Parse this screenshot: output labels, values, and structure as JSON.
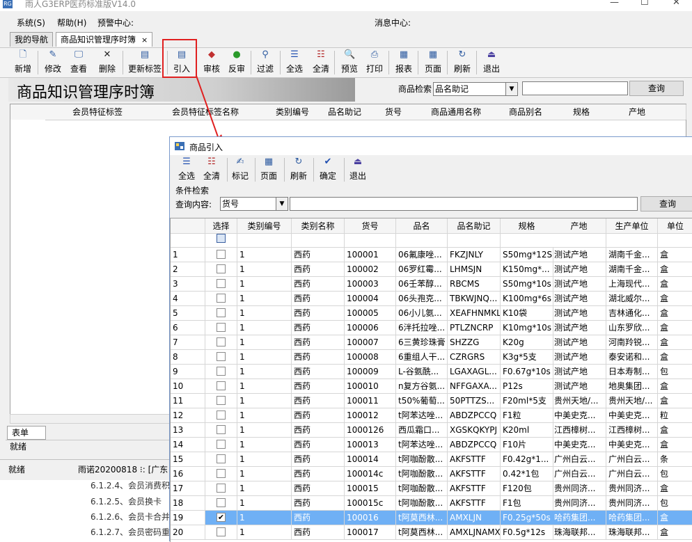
{
  "window": {
    "title": "雨人G3ERP医药标准版V14.0"
  },
  "menu": {
    "system": "系统(S)",
    "help": "帮助(H)",
    "warning": "预警中心:",
    "message": "消息中心:"
  },
  "tabs": [
    {
      "label": "我的导航"
    },
    {
      "label": "商品知识管理序时簿"
    }
  ],
  "tab_close": "×",
  "toolbar": [
    {
      "label": "新增",
      "icon": "new-icon"
    },
    {
      "label": "修改",
      "icon": "edit-icon"
    },
    {
      "label": "查看",
      "icon": "view-icon"
    },
    {
      "label": "删除",
      "icon": "delete-icon"
    },
    {
      "label": "更新标签",
      "icon": "update-tag-icon"
    },
    {
      "label": "引入",
      "icon": "import-icon"
    },
    {
      "label": "审核",
      "icon": "audit-icon"
    },
    {
      "label": "反审",
      "icon": "unaudit-icon"
    },
    {
      "label": "过滤",
      "icon": "filter-icon"
    },
    {
      "label": "全选",
      "icon": "select-all-icon"
    },
    {
      "label": "全清",
      "icon": "clear-all-icon"
    },
    {
      "label": "预览",
      "icon": "preview-icon"
    },
    {
      "label": "打印",
      "icon": "print-icon"
    },
    {
      "label": "报表",
      "icon": "report-icon"
    },
    {
      "label": "页面",
      "icon": "page-icon"
    },
    {
      "label": "刷新",
      "icon": "refresh-icon"
    },
    {
      "label": "退出",
      "icon": "exit-icon"
    }
  ],
  "banner": {
    "title": "商品知识管理序时簿"
  },
  "search": {
    "label": "商品检索",
    "field": "品名助记",
    "button": "查询"
  },
  "main_grid": {
    "columns": [
      "会员特征标签",
      "会员特征标签名称",
      "类别编号",
      "品名助记",
      "货号",
      "商品通用名称",
      "商品别名",
      "规格",
      "产地"
    ]
  },
  "bottom_tab": "表单",
  "status": {
    "ready": "就绪",
    "ready2": "就绪",
    "info": "雨诺20200818 ⁝: [广东"
  },
  "doc_lines": [
    "6.1.2.4、会员消费积分",
    "6.1.2.5、会员换卡",
    "6.1.2.6、会员卡合并",
    "6.1.2.7、会员密码重置"
  ],
  "dialog": {
    "title": "商品引入",
    "toolbar": [
      {
        "label": "全选",
        "icon": "select-all-icon"
      },
      {
        "label": "全清",
        "icon": "clear-all-icon"
      },
      {
        "label": "标记",
        "icon": "mark-icon"
      },
      {
        "label": "页面",
        "icon": "page-icon"
      },
      {
        "label": "刷新",
        "icon": "refresh-icon"
      },
      {
        "label": "确定",
        "icon": "check-icon"
      },
      {
        "label": "退出",
        "icon": "exit-icon"
      }
    ],
    "condition_label": "条件检索",
    "query_label": "查询内容:",
    "query_field": "货号",
    "query_button": "查询",
    "columns": [
      "选择",
      "类别编号",
      "类别名称",
      "货号",
      "品名",
      "品名助记",
      "规格",
      "产地",
      "生产单位",
      "单位"
    ],
    "rows": [
      {
        "n": "1",
        "checked": false,
        "cat": "1",
        "catname": "西药",
        "code": "100001",
        "name": "06氟康唑...",
        "mnem": "FKZJNLY",
        "spec": "S50mg*12S",
        "origin": "测试产地",
        "maker": "湖南千金...",
        "unit": "盒"
      },
      {
        "n": "2",
        "checked": false,
        "cat": "1",
        "catname": "西药",
        "code": "100002",
        "name": "06罗红霉...",
        "mnem": "LHMSJN",
        "spec": "K150mg*...",
        "origin": "测试产地",
        "maker": "湖南千金...",
        "unit": "盒"
      },
      {
        "n": "3",
        "checked": false,
        "cat": "1",
        "catname": "西药",
        "code": "100003",
        "name": "06壬苯醇...",
        "mnem": "RBCMS",
        "spec": "S50mg*10s",
        "origin": "测试产地",
        "maker": "上海现代...",
        "unit": "盒"
      },
      {
        "n": "4",
        "checked": false,
        "cat": "1",
        "catname": "西药",
        "code": "100004",
        "name": "06头孢克...",
        "mnem": "TBKWJNQ...",
        "spec": "K100mg*6s",
        "origin": "测试产地",
        "maker": "湖北威尔...",
        "unit": "盒"
      },
      {
        "n": "5",
        "checked": false,
        "cat": "1",
        "catname": "西药",
        "code": "100005",
        "name": "06小儿氨...",
        "mnem": "XEAFHNMKL",
        "spec": "K10袋",
        "origin": "测试产地",
        "maker": "吉林通化...",
        "unit": "盒"
      },
      {
        "n": "6",
        "checked": false,
        "cat": "1",
        "catname": "西药",
        "code": "100006",
        "name": "6泮托拉唑...",
        "mnem": "PTLZNCRP",
        "spec": "K10mg*10s",
        "origin": "测试产地",
        "maker": "山东罗欣...",
        "unit": "盒"
      },
      {
        "n": "7",
        "checked": false,
        "cat": "1",
        "catname": "西药",
        "code": "100007",
        "name": "6三黄珍珠膏",
        "mnem": "SHZZG",
        "spec": "K20g",
        "origin": "测试产地",
        "maker": "河南羚锐...",
        "unit": "盒"
      },
      {
        "n": "8",
        "checked": false,
        "cat": "1",
        "catname": "西药",
        "code": "100008",
        "name": "6重组人干...",
        "mnem": "CZRGRS",
        "spec": "K3g*5支",
        "origin": "测试产地",
        "maker": "泰安诺和...",
        "unit": "盒"
      },
      {
        "n": "9",
        "checked": false,
        "cat": "1",
        "catname": "西药",
        "code": "100009",
        "name": "L-谷氨酰...",
        "mnem": "LGAXAGL...",
        "spec": "F0.67g*10s",
        "origin": "测试产地",
        "maker": "日本寿制...",
        "unit": "包"
      },
      {
        "n": "10",
        "checked": false,
        "cat": "1",
        "catname": "西药",
        "code": "100010",
        "name": "n复方谷氨...",
        "mnem": "NFFGAXA...",
        "spec": "P12s",
        "origin": "测试产地",
        "maker": "地奥集团...",
        "unit": "盒"
      },
      {
        "n": "11",
        "checked": false,
        "cat": "1",
        "catname": "西药",
        "code": "100011",
        "name": "t50%葡萄...",
        "mnem": "50PTTZS...",
        "spec": "F20ml*5支",
        "origin": "贵州天地/...",
        "maker": "贵州天地/...",
        "unit": "盒"
      },
      {
        "n": "12",
        "checked": false,
        "cat": "1",
        "catname": "西药",
        "code": "100012",
        "name": "t阿苯达唑...",
        "mnem": "ABDZPCCQ",
        "spec": "F1粒",
        "origin": "中美史克...",
        "maker": "中美史克...",
        "unit": "粒"
      },
      {
        "n": "13",
        "checked": false,
        "cat": "1",
        "catname": "西药",
        "code": "1000126",
        "name": "西瓜霜口...",
        "mnem": "XGSKQKYPJ",
        "spec": "K20ml",
        "origin": "江西樟树...",
        "maker": "江西樟树...",
        "unit": "盒"
      },
      {
        "n": "14",
        "checked": false,
        "cat": "1",
        "catname": "西药",
        "code": "100013",
        "name": "t阿苯达唑...",
        "mnem": "ABDZPCCQ",
        "spec": "F10片",
        "origin": "中美史克...",
        "maker": "中美史克...",
        "unit": "盒"
      },
      {
        "n": "15",
        "checked": false,
        "cat": "1",
        "catname": "西药",
        "code": "100014",
        "name": "t阿咖酚散...",
        "mnem": "AKFSTTF",
        "spec": "F0.42g*1...",
        "origin": "广州白云...",
        "maker": "广州白云...",
        "unit": "条"
      },
      {
        "n": "16",
        "checked": false,
        "cat": "1",
        "catname": "西药",
        "code": "100014c",
        "name": "t阿咖酚散...",
        "mnem": "AKFSTTF",
        "spec": "0.42*1包",
        "origin": "广州白云...",
        "maker": "广州白云...",
        "unit": "包"
      },
      {
        "n": "17",
        "checked": false,
        "cat": "1",
        "catname": "西药",
        "code": "100015",
        "name": "t阿咖酚散...",
        "mnem": "AKFSTTF",
        "spec": "F120包",
        "origin": "贵州同济...",
        "maker": "贵州同济...",
        "unit": "盒"
      },
      {
        "n": "18",
        "checked": false,
        "cat": "1",
        "catname": "西药",
        "code": "100015c",
        "name": "t阿咖酚散...",
        "mnem": "AKFSTTF",
        "spec": "F1包",
        "origin": "贵州同济...",
        "maker": "贵州同济...",
        "unit": "包"
      },
      {
        "n": "19",
        "checked": true,
        "cat": "1",
        "catname": "西药",
        "code": "100016",
        "name": "t阿莫西林...",
        "mnem": "AMXLJN",
        "spec": "F0.25g*50s",
        "origin": "哈药集团...",
        "maker": "哈药集团...",
        "unit": "盒"
      },
      {
        "n": "20",
        "checked": false,
        "cat": "1",
        "catname": "西药",
        "code": "100017",
        "name": "t阿莫西林...",
        "mnem": "AMXLJNAMX",
        "spec": "F0.5g*12s",
        "origin": "珠海联邦...",
        "maker": "珠海联邦...",
        "unit": "盒"
      }
    ]
  }
}
